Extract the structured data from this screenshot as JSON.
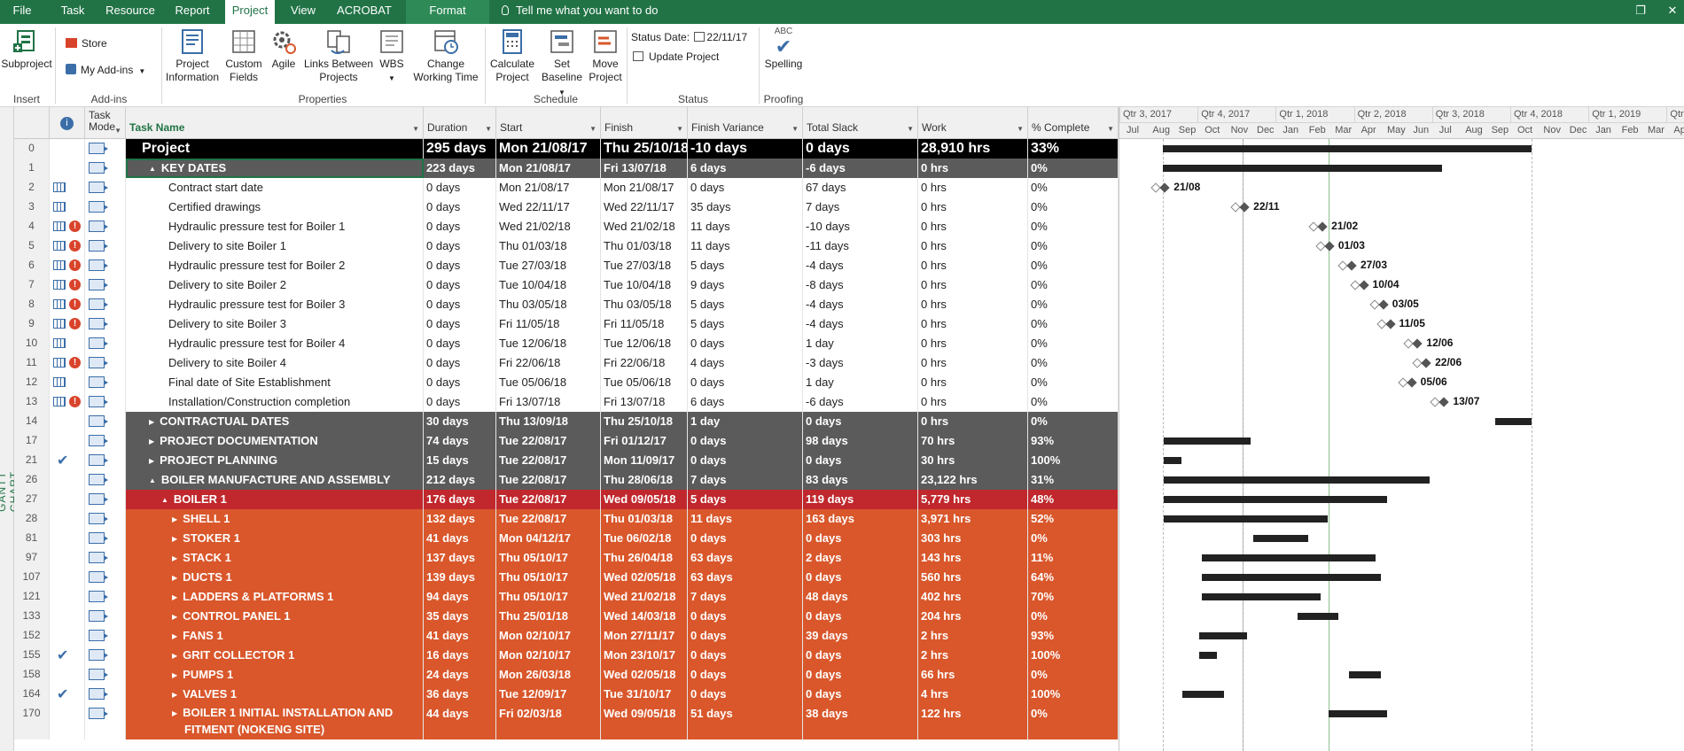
{
  "tabs": [
    "File",
    "Task",
    "Resource",
    "Report",
    "Project",
    "View",
    "ACROBAT",
    "Format"
  ],
  "active_tab": "Project",
  "tell_me": "Tell me what you want to do",
  "ribbon": {
    "insert": {
      "subproject": "Subproject",
      "label": "Insert"
    },
    "addins": {
      "store": "Store",
      "my_addins": "My Add-ins",
      "label": "Add-ins"
    },
    "properties": {
      "project_information": [
        "Project",
        "Information"
      ],
      "custom_fields": [
        "Custom",
        "Fields"
      ],
      "agile": "Agile",
      "links_between_projects": [
        "Links Between",
        "Projects"
      ],
      "wbs": "WBS",
      "change_working_time": [
        "Change",
        "Working Time"
      ],
      "label": "Properties"
    },
    "schedule": {
      "calculate_project": [
        "Calculate",
        "Project"
      ],
      "set_baseline": [
        "Set",
        "Baseline"
      ],
      "move_project": [
        "Move",
        "Project"
      ],
      "label": "Schedule"
    },
    "status": {
      "status_date_label": "Status Date:",
      "status_date": "22/11/17",
      "update_project": "Update Project",
      "label": "Status"
    },
    "proofing": {
      "spelling": "Spelling",
      "abc": "ABC",
      "label": "Proofing"
    }
  },
  "side_label": "GANTT CHART",
  "columns": {
    "task_mode": [
      "Task",
      "Mode"
    ],
    "task_name": "Task Name",
    "duration": "Duration",
    "start": "Start",
    "finish": "Finish",
    "finish_variance": "Finish Variance",
    "total_slack": "Total Slack",
    "work": "Work",
    "pct_complete": "% Complete"
  },
  "rows": [
    {
      "id": "0",
      "name": "Project",
      "duration": "295 days",
      "start": "Mon 21/08/17",
      "finish": "Thu 25/10/18",
      "variance": "-10 days",
      "slack": "0 days",
      "work": "28,910 hrs",
      "pct": "33%"
    },
    {
      "id": "1",
      "name": "KEY DATES",
      "duration": "223 days",
      "start": "Mon 21/08/17",
      "finish": "Fri 13/07/18",
      "variance": "6 days",
      "slack": "-6 days",
      "work": "0 hrs",
      "pct": "0%"
    },
    {
      "id": "2",
      "name": "Contract start date",
      "duration": "0 days",
      "start": "Mon 21/08/17",
      "finish": "Mon 21/08/17",
      "variance": "0 days",
      "slack": "67 days",
      "work": "0 hrs",
      "pct": "0%"
    },
    {
      "id": "3",
      "name": "Certified drawings",
      "duration": "0 days",
      "start": "Wed 22/11/17",
      "finish": "Wed 22/11/17",
      "variance": "35 days",
      "slack": "7 days",
      "work": "0 hrs",
      "pct": "0%"
    },
    {
      "id": "4",
      "name": "Hydraulic pressure test for Boiler 1",
      "duration": "0 days",
      "start": "Wed 21/02/18",
      "finish": "Wed 21/02/18",
      "variance": "11 days",
      "slack": "-10 days",
      "work": "0 hrs",
      "pct": "0%"
    },
    {
      "id": "5",
      "name": "Delivery to site Boiler 1",
      "duration": "0 days",
      "start": "Thu 01/03/18",
      "finish": "Thu 01/03/18",
      "variance": "11 days",
      "slack": "-11 days",
      "work": "0 hrs",
      "pct": "0%"
    },
    {
      "id": "6",
      "name": "Hydraulic pressure test for Boiler 2",
      "duration": "0 days",
      "start": "Tue 27/03/18",
      "finish": "Tue 27/03/18",
      "variance": "5 days",
      "slack": "-4 days",
      "work": "0 hrs",
      "pct": "0%"
    },
    {
      "id": "7",
      "name": "Delivery to site Boiler 2",
      "duration": "0 days",
      "start": "Tue 10/04/18",
      "finish": "Tue 10/04/18",
      "variance": "9 days",
      "slack": "-8 days",
      "work": "0 hrs",
      "pct": "0%"
    },
    {
      "id": "8",
      "name": "Hydraulic pressure test for Boiler 3",
      "duration": "0 days",
      "start": "Thu 03/05/18",
      "finish": "Thu 03/05/18",
      "variance": "5 days",
      "slack": "-4 days",
      "work": "0 hrs",
      "pct": "0%"
    },
    {
      "id": "9",
      "name": "Delivery to site Boiler 3",
      "duration": "0 days",
      "start": "Fri 11/05/18",
      "finish": "Fri 11/05/18",
      "variance": "5 days",
      "slack": "-4 days",
      "work": "0 hrs",
      "pct": "0%"
    },
    {
      "id": "10",
      "name": "Hydraulic pressure test for Boiler 4",
      "duration": "0 days",
      "start": "Tue 12/06/18",
      "finish": "Tue 12/06/18",
      "variance": "0 days",
      "slack": "1 day",
      "work": "0 hrs",
      "pct": "0%"
    },
    {
      "id": "11",
      "name": "Delivery to site Boiler 4",
      "duration": "0 days",
      "start": "Fri 22/06/18",
      "finish": "Fri 22/06/18",
      "variance": "4 days",
      "slack": "-3 days",
      "work": "0 hrs",
      "pct": "0%"
    },
    {
      "id": "12",
      "name": "Final date of Site Establishment",
      "duration": "0 days",
      "start": "Tue 05/06/18",
      "finish": "Tue 05/06/18",
      "variance": "0 days",
      "slack": "1 day",
      "work": "0 hrs",
      "pct": "0%"
    },
    {
      "id": "13",
      "name": "Installation/Construction completion",
      "duration": "0 days",
      "start": "Fri 13/07/18",
      "finish": "Fri 13/07/18",
      "variance": "6 days",
      "slack": "-6 days",
      "work": "0 hrs",
      "pct": "0%"
    },
    {
      "id": "14",
      "name": "CONTRACTUAL DATES",
      "duration": "30 days",
      "start": "Thu 13/09/18",
      "finish": "Thu 25/10/18",
      "variance": "1 day",
      "slack": "0 days",
      "work": "0 hrs",
      "pct": "0%"
    },
    {
      "id": "17",
      "name": "PROJECT DOCUMENTATION",
      "duration": "74 days",
      "start": "Tue 22/08/17",
      "finish": "Fri 01/12/17",
      "variance": "0 days",
      "slack": "98 days",
      "work": "70 hrs",
      "pct": "93%"
    },
    {
      "id": "21",
      "name": "PROJECT PLANNING",
      "duration": "15 days",
      "start": "Tue 22/08/17",
      "finish": "Mon 11/09/17",
      "variance": "0 days",
      "slack": "0 days",
      "work": "30 hrs",
      "pct": "100%"
    },
    {
      "id": "26",
      "name": "BOILER MANUFACTURE AND ASSEMBLY",
      "duration": "212 days",
      "start": "Tue 22/08/17",
      "finish": "Thu 28/06/18",
      "variance": "7 days",
      "slack": "83 days",
      "work": "23,122 hrs",
      "pct": "31%"
    },
    {
      "id": "27",
      "name": "BOILER 1",
      "duration": "176 days",
      "start": "Tue 22/08/17",
      "finish": "Wed 09/05/18",
      "variance": "5 days",
      "slack": "119 days",
      "work": "5,779 hrs",
      "pct": "48%"
    },
    {
      "id": "28",
      "name": "SHELL 1",
      "duration": "132 days",
      "start": "Tue 22/08/17",
      "finish": "Thu 01/03/18",
      "variance": "11 days",
      "slack": "163 days",
      "work": "3,971 hrs",
      "pct": "52%"
    },
    {
      "id": "81",
      "name": "STOKER 1",
      "duration": "41 days",
      "start": "Mon 04/12/17",
      "finish": "Tue 06/02/18",
      "variance": "0 days",
      "slack": "0 days",
      "work": "303 hrs",
      "pct": "0%"
    },
    {
      "id": "97",
      "name": "STACK 1",
      "duration": "137 days",
      "start": "Thu 05/10/17",
      "finish": "Thu 26/04/18",
      "variance": "63 days",
      "slack": "2 days",
      "work": "143 hrs",
      "pct": "11%"
    },
    {
      "id": "107",
      "name": "DUCTS 1",
      "duration": "139 days",
      "start": "Thu 05/10/17",
      "finish": "Wed 02/05/18",
      "variance": "63 days",
      "slack": "0 days",
      "work": "560 hrs",
      "pct": "64%"
    },
    {
      "id": "121",
      "name": "LADDERS & PLATFORMS 1",
      "duration": "94 days",
      "start": "Thu 05/10/17",
      "finish": "Wed 21/02/18",
      "variance": "7 days",
      "slack": "48 days",
      "work": "402 hrs",
      "pct": "70%"
    },
    {
      "id": "133",
      "name": "CONTROL PANEL 1",
      "duration": "35 days",
      "start": "Thu 25/01/18",
      "finish": "Wed 14/03/18",
      "variance": "0 days",
      "slack": "0 days",
      "work": "204 hrs",
      "pct": "0%"
    },
    {
      "id": "152",
      "name": "FANS 1",
      "duration": "41 days",
      "start": "Mon 02/10/17",
      "finish": "Mon 27/11/17",
      "variance": "0 days",
      "slack": "39 days",
      "work": "2 hrs",
      "pct": "93%"
    },
    {
      "id": "155",
      "name": "GRIT COLLECTOR 1",
      "duration": "16 days",
      "start": "Mon 02/10/17",
      "finish": "Mon 23/10/17",
      "variance": "0 days",
      "slack": "0 days",
      "work": "2 hrs",
      "pct": "100%"
    },
    {
      "id": "158",
      "name": "PUMPS 1",
      "duration": "24 days",
      "start": "Mon 26/03/18",
      "finish": "Wed 02/05/18",
      "variance": "0 days",
      "slack": "0 days",
      "work": "66 hrs",
      "pct": "0%"
    },
    {
      "id": "164",
      "name": "VALVES 1",
      "duration": "36 days",
      "start": "Tue 12/09/17",
      "finish": "Tue 31/10/17",
      "variance": "0 days",
      "slack": "0 days",
      "work": "4 hrs",
      "pct": "100%"
    },
    {
      "id": "170",
      "name": "BOILER 1 INITIAL INSTALLATION AND FITMENT (NOKENG SITE)",
      "name2": "FITMENT (NOKENG SITE)",
      "name1": "BOILER 1 INITIAL INSTALLATION AND",
      "duration": "44 days",
      "start": "Fri 02/03/18",
      "finish": "Wed 09/05/18",
      "variance": "51 days",
      "slack": "38 days",
      "work": "122 hrs",
      "pct": "0%"
    }
  ],
  "timeline": {
    "quarters": [
      "Qtr 3, 2017",
      "Qtr 4, 2017",
      "Qtr 1, 2018",
      "Qtr 2, 2018",
      "Qtr 3, 2018",
      "Qtr 4, 2018",
      "Qtr 1, 2019",
      "Qtr"
    ],
    "months": [
      "Jul",
      "Aug",
      "Sep",
      "Oct",
      "Nov",
      "Dec",
      "Jan",
      "Feb",
      "Mar",
      "Apr",
      "May",
      "Jun",
      "Jul",
      "Aug",
      "Sep",
      "Oct",
      "Nov",
      "Dec",
      "Jan",
      "Feb",
      "Mar",
      "Apr"
    ]
  },
  "milestone_labels": [
    "21/08",
    "22/11",
    "21/02",
    "01/03",
    "27/03",
    "10/04",
    "03/05",
    "11/05",
    "12/06",
    "22/06",
    "05/06",
    "13/07"
  ],
  "colors": {
    "ribbon": "#217346",
    "summary": "#5b5b5b",
    "boiler": "#c0282d",
    "subsummary": "#d9572b",
    "project": "#000000"
  }
}
